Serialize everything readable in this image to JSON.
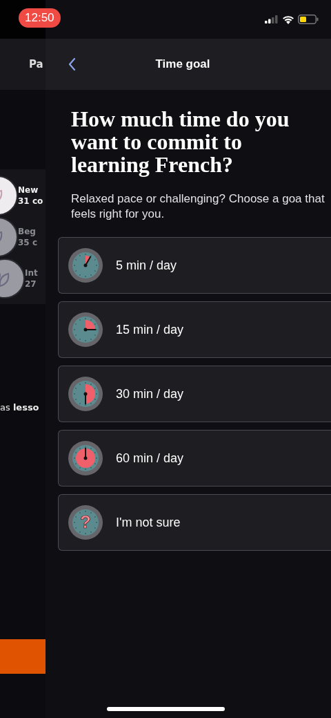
{
  "status_bar": {
    "time": "12:50"
  },
  "background_screen": {
    "nav_title": "Pa",
    "courses": [
      {
        "title": "New",
        "subtitle": "31 co",
        "dimmed": false
      },
      {
        "title": "Beg",
        "subtitle": "35 c",
        "dimmed": true
      },
      {
        "title": "Int",
        "subtitle": "27",
        "dimmed": true
      }
    ],
    "footer_text": "as **lesso**"
  },
  "nav": {
    "title": "Time goal"
  },
  "heading": "How much time do you want to commit to learning French?",
  "subtitle": "Relaxed pace or challenging? Choose a goa that feels right for you.",
  "options": [
    {
      "kind": "twelfth",
      "label": "5 min / day"
    },
    {
      "kind": "quarter",
      "label": "15 min / day"
    },
    {
      "kind": "half",
      "label": "30 min / day"
    },
    {
      "kind": "full",
      "label": "60 min / day"
    },
    {
      "kind": "unknown",
      "label": "I'm not sure",
      "symbol": "?"
    }
  ]
}
